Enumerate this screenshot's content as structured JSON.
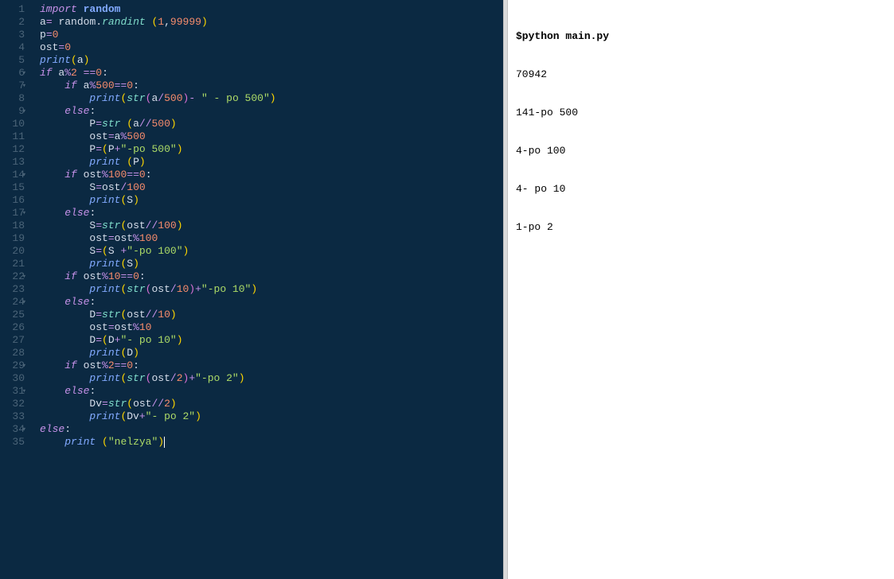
{
  "editor": {
    "gutter": [
      {
        "n": "1",
        "fold": false
      },
      {
        "n": "2",
        "fold": false
      },
      {
        "n": "3",
        "fold": false
      },
      {
        "n": "4",
        "fold": false
      },
      {
        "n": "5",
        "fold": false
      },
      {
        "n": "6",
        "fold": true
      },
      {
        "n": "7",
        "fold": true
      },
      {
        "n": "8",
        "fold": false
      },
      {
        "n": "9",
        "fold": true
      },
      {
        "n": "10",
        "fold": false
      },
      {
        "n": "11",
        "fold": false
      },
      {
        "n": "12",
        "fold": false
      },
      {
        "n": "13",
        "fold": false
      },
      {
        "n": "14",
        "fold": true
      },
      {
        "n": "15",
        "fold": false
      },
      {
        "n": "16",
        "fold": false
      },
      {
        "n": "17",
        "fold": true
      },
      {
        "n": "18",
        "fold": false
      },
      {
        "n": "19",
        "fold": false
      },
      {
        "n": "20",
        "fold": false
      },
      {
        "n": "21",
        "fold": false
      },
      {
        "n": "22",
        "fold": true
      },
      {
        "n": "23",
        "fold": false
      },
      {
        "n": "24",
        "fold": true
      },
      {
        "n": "25",
        "fold": false
      },
      {
        "n": "26",
        "fold": false
      },
      {
        "n": "27",
        "fold": false
      },
      {
        "n": "28",
        "fold": false
      },
      {
        "n": "29",
        "fold": true
      },
      {
        "n": "30",
        "fold": false
      },
      {
        "n": "31",
        "fold": true
      },
      {
        "n": "32",
        "fold": false
      },
      {
        "n": "33",
        "fold": false
      },
      {
        "n": "34",
        "fold": true
      },
      {
        "n": "35",
        "fold": false
      }
    ],
    "tokens": {
      "import": "import",
      "random": "random",
      "a": "a",
      "eq": "=",
      "dot": ".",
      "randint": "randint",
      "sp": " ",
      "lp": "(",
      "rp": ")",
      "lp2": "(",
      "rp2": ")",
      "n1": "1",
      "comma": ",",
      "n99999": "99999",
      "p": "p",
      "n0": "0",
      "ost": "ost",
      "print": "print",
      "if": "if",
      "mod": "%",
      "n2": "2",
      "eqeq": "==",
      "colon": ":",
      "n500": "500",
      "str": "str",
      "div": "/",
      "minus": "-",
      "s_po500": "\" - po 500\"",
      "else": "else",
      "Pv": "P",
      "fdiv": "//",
      "plus": "+",
      "s_po500b": "\"-po 500\"",
      "n100": "100",
      "Sv": "S",
      "s_po100": "\"-po 100\"",
      "n10": "10",
      "s_po10": "\"-po 10\"",
      "Dv": "D",
      "s_po10b": "\"- po 10\"",
      "s_po2": "\"-po 2\"",
      "Dvv": "Dv",
      "s_po2b": "\"- po 2\"",
      "s_nelzya": "\"nelzya\""
    }
  },
  "output": {
    "cmd": "$python main.py",
    "lines": [
      "70942",
      "141-po 500",
      "4-po 100",
      "4- po 10",
      "1-po 2"
    ]
  }
}
